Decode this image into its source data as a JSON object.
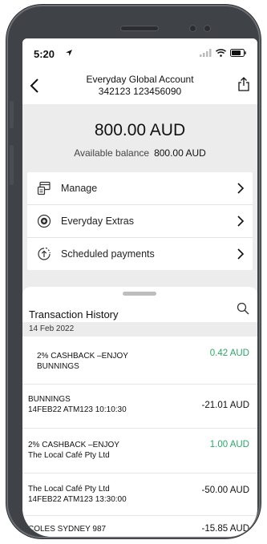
{
  "status_bar": {
    "time": "5:20"
  },
  "header": {
    "account_name": "Everyday Global Account",
    "account_number": "342123 123456090"
  },
  "balance": {
    "amount": "800.00 AUD",
    "available_label": "Available balance",
    "available_value": "800.00 AUD"
  },
  "menu": {
    "items": [
      {
        "label": "Manage",
        "icon": "manage-icon"
      },
      {
        "label": "Everyday Extras",
        "icon": "extras-icon"
      },
      {
        "label": "Scheduled payments",
        "icon": "scheduled-icon"
      }
    ]
  },
  "transactions": {
    "title": "Transaction History",
    "date": "14 Feb 2022",
    "items": [
      {
        "line1": "2% CASHBACK –ENJOY",
        "line2": "BUNNINGS",
        "amount": "0.42 AUD",
        "positive": true
      },
      {
        "line1": "BUNNINGS",
        "line2": "14FEB22 ATM123 10:10:30",
        "amount": "-21.01 AUD",
        "positive": false
      },
      {
        "line1": "2% CASHBACK –ENJOY",
        "line2": "The Local Café Pty Ltd",
        "amount": "1.00 AUD",
        "positive": true
      },
      {
        "line1": "The Local Café Pty Ltd",
        "line2": "14FEB22 ATM123 13:30:00",
        "amount": "-50.00 AUD",
        "positive": false
      },
      {
        "line1": "COLES SYDNEY 987",
        "line2": "",
        "amount": "-15.85 AUD",
        "positive": false
      }
    ]
  },
  "colors": {
    "positive": "#2ea56a",
    "panel": "#ececec",
    "frame": "#3f4246"
  }
}
